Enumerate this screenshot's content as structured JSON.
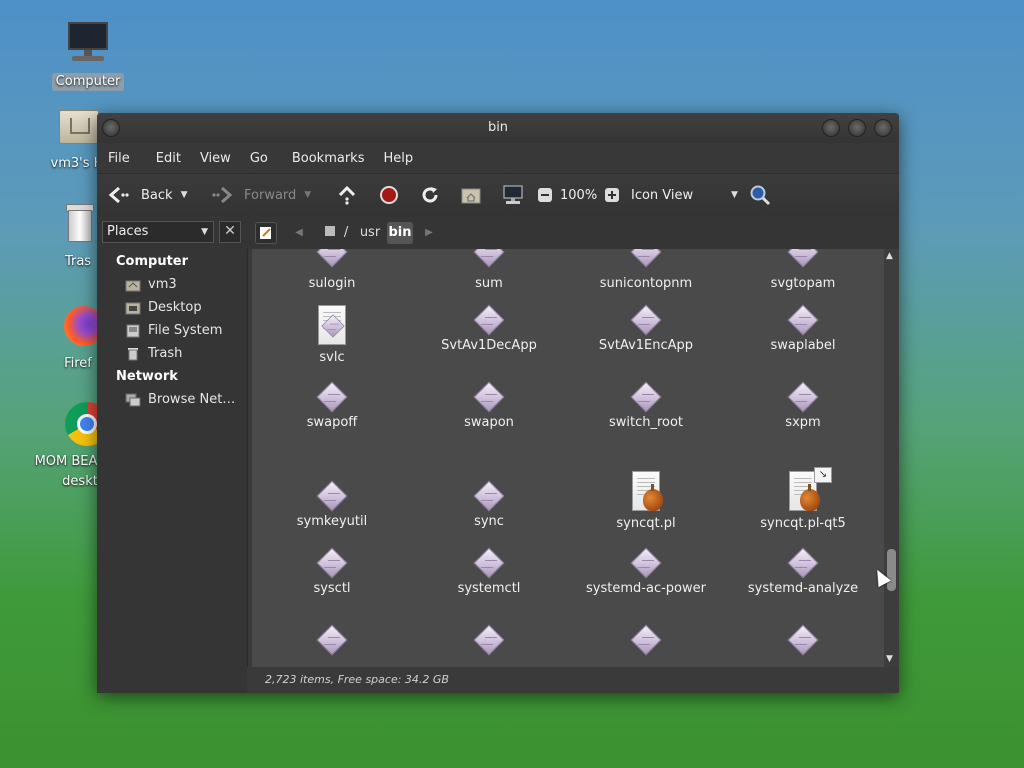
{
  "desktop": {
    "icons": [
      {
        "label": "Computer",
        "icon": "computer-icon",
        "selected": true
      },
      {
        "label": "vm3's H",
        "icon": "home-folder-icon"
      },
      {
        "label": "Tras",
        "icon": "trash-icon"
      },
      {
        "label": "Firef",
        "icon": "firefox-icon"
      },
      {
        "label": "MOM BEA",
        "label2": "deskt",
        "icon": "chrome-icon"
      }
    ]
  },
  "window": {
    "title": "bin",
    "menu": [
      "File",
      "Edit",
      "View",
      "Go",
      "Bookmarks",
      "Help"
    ],
    "toolbar": {
      "back": "Back",
      "forward": "Forward",
      "zoom": "100%",
      "view_mode": "Icon View"
    },
    "sidebar": {
      "combo": "Places",
      "close": "✕",
      "sections": [
        {
          "heading": "Computer",
          "items": [
            {
              "label": "vm3",
              "icon": "home-icon"
            },
            {
              "label": "Desktop",
              "icon": "desktop-icon"
            },
            {
              "label": "File System",
              "icon": "drive-icon"
            },
            {
              "label": "Trash",
              "icon": "trash-icon"
            }
          ]
        },
        {
          "heading": "Network",
          "items": [
            {
              "label": "Browse Net…",
              "icon": "network-icon"
            }
          ]
        }
      ]
    },
    "path": [
      "/",
      "usr",
      "bin"
    ],
    "files": [
      {
        "name": "sulogin",
        "type": "exec"
      },
      {
        "name": "sum",
        "type": "exec"
      },
      {
        "name": "sunicontopnm",
        "type": "exec"
      },
      {
        "name": "svgtopam",
        "type": "exec"
      },
      {
        "name": "svlc",
        "type": "script"
      },
      {
        "name": "SvtAv1DecApp",
        "type": "exec"
      },
      {
        "name": "SvtAv1EncApp",
        "type": "exec"
      },
      {
        "name": "swaplabel",
        "type": "exec"
      },
      {
        "name": "swapoff",
        "type": "exec"
      },
      {
        "name": "swapon",
        "type": "exec"
      },
      {
        "name": "switch_root",
        "type": "exec"
      },
      {
        "name": "sxpm",
        "type": "exec"
      },
      {
        "name": "symkeyutil",
        "type": "exec"
      },
      {
        "name": "sync",
        "type": "exec"
      },
      {
        "name": "syncqt.pl",
        "type": "perl"
      },
      {
        "name": "syncqt.pl-qt5",
        "type": "perl-link"
      },
      {
        "name": "sysctl",
        "type": "exec"
      },
      {
        "name": "systemctl",
        "type": "exec"
      },
      {
        "name": "systemd-ac-power",
        "type": "exec"
      },
      {
        "name": "systemd-analyze",
        "type": "exec"
      },
      {
        "name": "",
        "type": "exec"
      },
      {
        "name": "",
        "type": "exec"
      },
      {
        "name": "",
        "type": "exec"
      },
      {
        "name": "",
        "type": "exec"
      }
    ],
    "status": "2,723 items, Free space: 34.2 GB"
  }
}
